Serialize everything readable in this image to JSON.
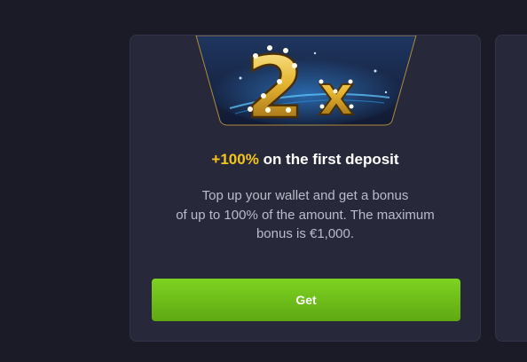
{
  "promo": {
    "badge_text": "2x",
    "title_accent": "+100%",
    "title_rest": " on the first deposit",
    "description_lines": [
      "Top up your wallet and get a bonus",
      "of up to 100% of the amount. The maximum",
      "bonus is €1,000."
    ],
    "button_label": "Get",
    "colors": {
      "accent": "#f5c518",
      "button": "#7ed321",
      "card_background": "#272839",
      "page_background": "#1a1b26"
    }
  }
}
